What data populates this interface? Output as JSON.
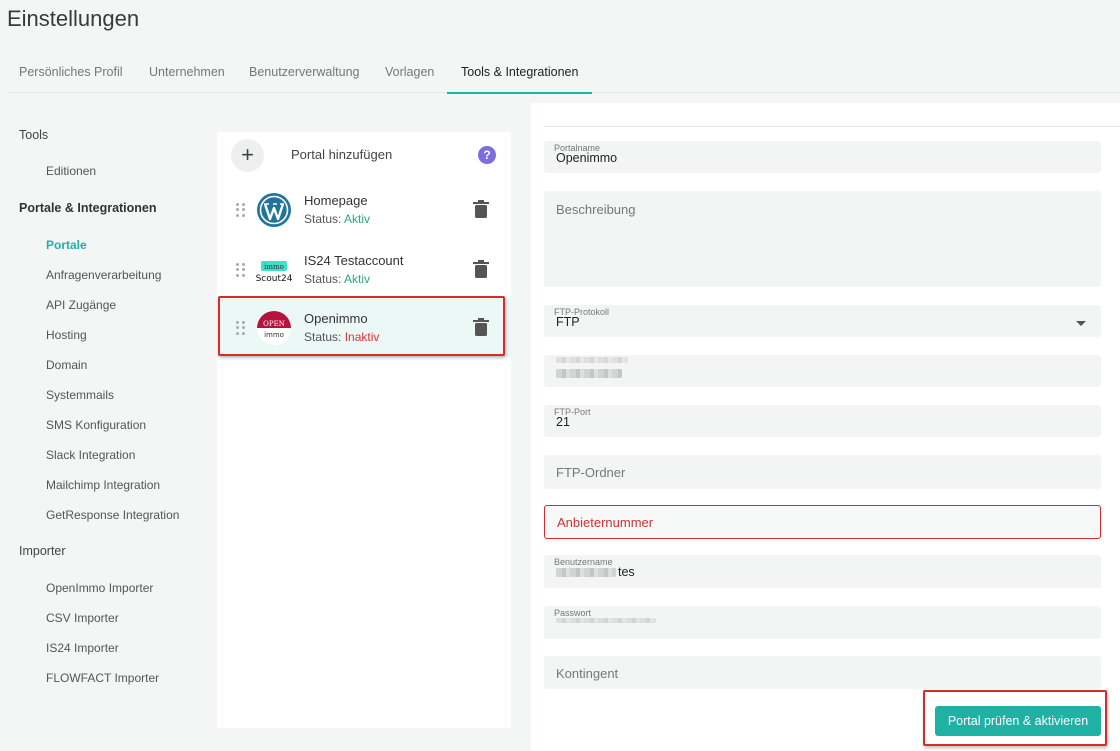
{
  "page": {
    "title": "Einstellungen"
  },
  "tabs": [
    {
      "label": "Persönliches Profil"
    },
    {
      "label": "Unternehmen"
    },
    {
      "label": "Benutzerverwaltung"
    },
    {
      "label": "Vorlagen"
    },
    {
      "label": "Tools & Integrationen",
      "active": true
    }
  ],
  "sidebar": {
    "tools": {
      "label": "Tools",
      "items": [
        {
          "label": "Editionen"
        }
      ]
    },
    "portale": {
      "label": "Portale & Integrationen",
      "items": [
        {
          "label": "Portale",
          "active": true
        },
        {
          "label": "Anfragenverarbeitung"
        },
        {
          "label": "API Zugänge"
        },
        {
          "label": "Hosting"
        },
        {
          "label": "Domain"
        },
        {
          "label": "Systemmails"
        },
        {
          "label": "SMS Konfiguration"
        },
        {
          "label": "Slack Integration"
        },
        {
          "label": "Mailchimp Integration"
        },
        {
          "label": "GetResponse Integration"
        }
      ]
    },
    "importer": {
      "label": "Importer",
      "items": [
        {
          "label": "OpenImmo Importer"
        },
        {
          "label": "CSV Importer"
        },
        {
          "label": "IS24 Importer"
        },
        {
          "label": "FLOWFACT Importer"
        }
      ]
    }
  },
  "portal_list": {
    "add_label": "Portal hinzufügen",
    "help_icon": "?",
    "status_prefix": "Status:",
    "items": [
      {
        "name": "Homepage",
        "status": "Aktiv",
        "logo": "wordpress-icon"
      },
      {
        "name": "IS24 Testaccount",
        "status": "Aktiv",
        "logo": "immoscout24-icon",
        "logo_top": "immo",
        "logo_bottom": "Scout24"
      },
      {
        "name": "Openimmo",
        "status": "Inaktiv",
        "logo": "openimmo-icon",
        "logo_top": "OPEN",
        "logo_bottom": "immo",
        "selected": true
      }
    ]
  },
  "form": {
    "portalname": {
      "label": "Portalname",
      "value": "Openimmo"
    },
    "beschreibung": {
      "placeholder": "Beschreibung"
    },
    "ftp_protokoll": {
      "label": "FTP-Protokoll",
      "value": "FTP"
    },
    "ftp_port": {
      "label": "FTP-Port",
      "value": "21"
    },
    "ftp_ordner": {
      "placeholder": "FTP-Ordner"
    },
    "anbieternummer": {
      "placeholder": "Anbieternummer"
    },
    "benutzername": {
      "label": "Benutzername",
      "value_suffix": "tes"
    },
    "passwort": {
      "label": "Passwort"
    },
    "kontingent": {
      "placeholder": "Kontingent"
    },
    "submit_label": "Portal prüfen & aktivieren"
  },
  "colors": {
    "accent": "#1fb1a4",
    "active_status": "#2aa879",
    "inactive_status": "#d93333",
    "highlight": "#d62b2b",
    "help": "#7a6ee0"
  }
}
